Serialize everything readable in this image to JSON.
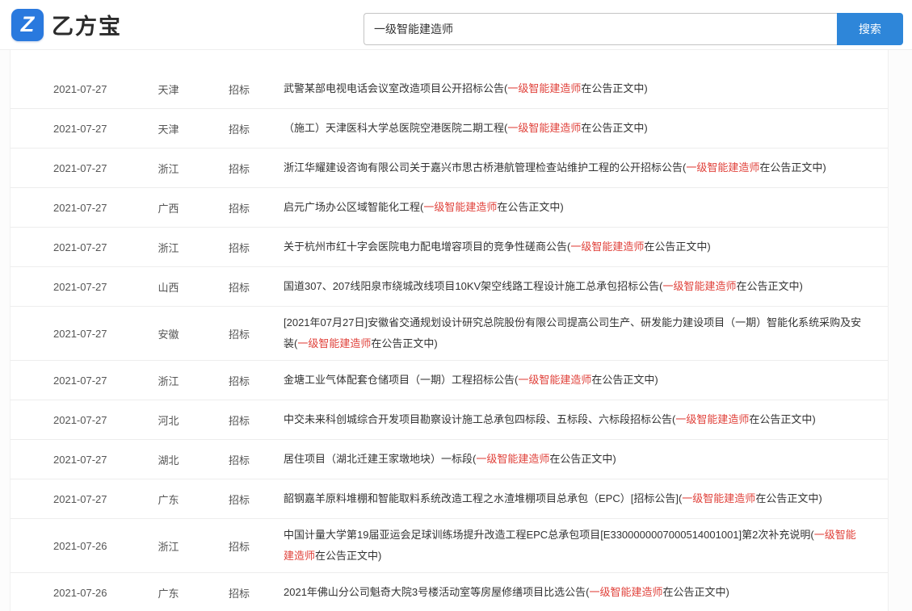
{
  "brand": {
    "logo_letter": "Z",
    "name": "乙方宝"
  },
  "search": {
    "value": "一级智能建造师",
    "button_label": "搜索"
  },
  "colors": {
    "accent_blue": "#2E86D9",
    "logo_blue": "#2979de",
    "keyword_red": "#e0423b"
  },
  "rows": [
    {
      "date": "2021-07-27",
      "region": "天津",
      "type": "招标",
      "title": "武警某部电视电话会议室改造项目公开招标公告(",
      "keyword": "一级智能建造师",
      "suffix": "在公告正文中)"
    },
    {
      "date": "2021-07-27",
      "region": "天津",
      "type": "招标",
      "title": "（施工）天津医科大学总医院空港医院二期工程(",
      "keyword": "一级智能建造师",
      "suffix": "在公告正文中)"
    },
    {
      "date": "2021-07-27",
      "region": "浙江",
      "type": "招标",
      "title": "浙江华耀建设咨询有限公司关于嘉兴市思古桥港航管理检查站维护工程的公开招标公告(",
      "keyword": "一级智能建造师",
      "suffix": "在公告正文中)"
    },
    {
      "date": "2021-07-27",
      "region": "广西",
      "type": "招标",
      "title": "启元广场办公区域智能化工程(",
      "keyword": "一级智能建造师",
      "suffix": "在公告正文中)"
    },
    {
      "date": "2021-07-27",
      "region": "浙江",
      "type": "招标",
      "title": "关于杭州市红十字会医院电力配电增容项目的竞争性磋商公告(",
      "keyword": "一级智能建造师",
      "suffix": "在公告正文中)"
    },
    {
      "date": "2021-07-27",
      "region": "山西",
      "type": "招标",
      "title": "国道307、207线阳泉市绕城改线项目10KV架空线路工程设计施工总承包招标公告(",
      "keyword": "一级智能建造师",
      "suffix": "在公告正文中)"
    },
    {
      "date": "2021-07-27",
      "region": "安徽",
      "type": "招标",
      "title": "[2021年07月27日]安徽省交通规划设计研究总院股份有限公司提高公司生产、研发能力建设项目（一期）智能化系统采购及安装(",
      "keyword": "一级智能建造师",
      "suffix": "在公告正文中)"
    },
    {
      "date": "2021-07-27",
      "region": "浙江",
      "type": "招标",
      "title": "金塘工业气体配套仓储项目（一期）工程招标公告(",
      "keyword": "一级智能建造师",
      "suffix": "在公告正文中)"
    },
    {
      "date": "2021-07-27",
      "region": "河北",
      "type": "招标",
      "title": "中交未来科创城综合开发项目勘察设计施工总承包四标段、五标段、六标段招标公告(",
      "keyword": "一级智能建造师",
      "suffix": "在公告正文中)"
    },
    {
      "date": "2021-07-27",
      "region": "湖北",
      "type": "招标",
      "title": "居住项目（湖北迁建王家墩地块）一标段(",
      "keyword": "一级智能建造师",
      "suffix": "在公告正文中)"
    },
    {
      "date": "2021-07-27",
      "region": "广东",
      "type": "招标",
      "title": "韶钢嘉羊原料堆棚和智能取料系统改造工程之水渣堆棚项目总承包（EPC）[招标公告](",
      "keyword": "一级智能建造师",
      "suffix": "在公告正文中)"
    },
    {
      "date": "2021-07-26",
      "region": "浙江",
      "type": "招标",
      "title": "中国计量大学第19届亚运会足球训练场提升改造工程EPC总承包项目[E3300000007000514001001]第2次补充说明(",
      "keyword": "一级智能建造师",
      "suffix": "在公告正文中)"
    },
    {
      "date": "2021-07-26",
      "region": "广东",
      "type": "招标",
      "title": "2021年佛山分公司魁奇大院3号楼活动室等房屋修缮项目比选公告(",
      "keyword": "一级智能建造师",
      "suffix": "在公告正文中)"
    }
  ]
}
